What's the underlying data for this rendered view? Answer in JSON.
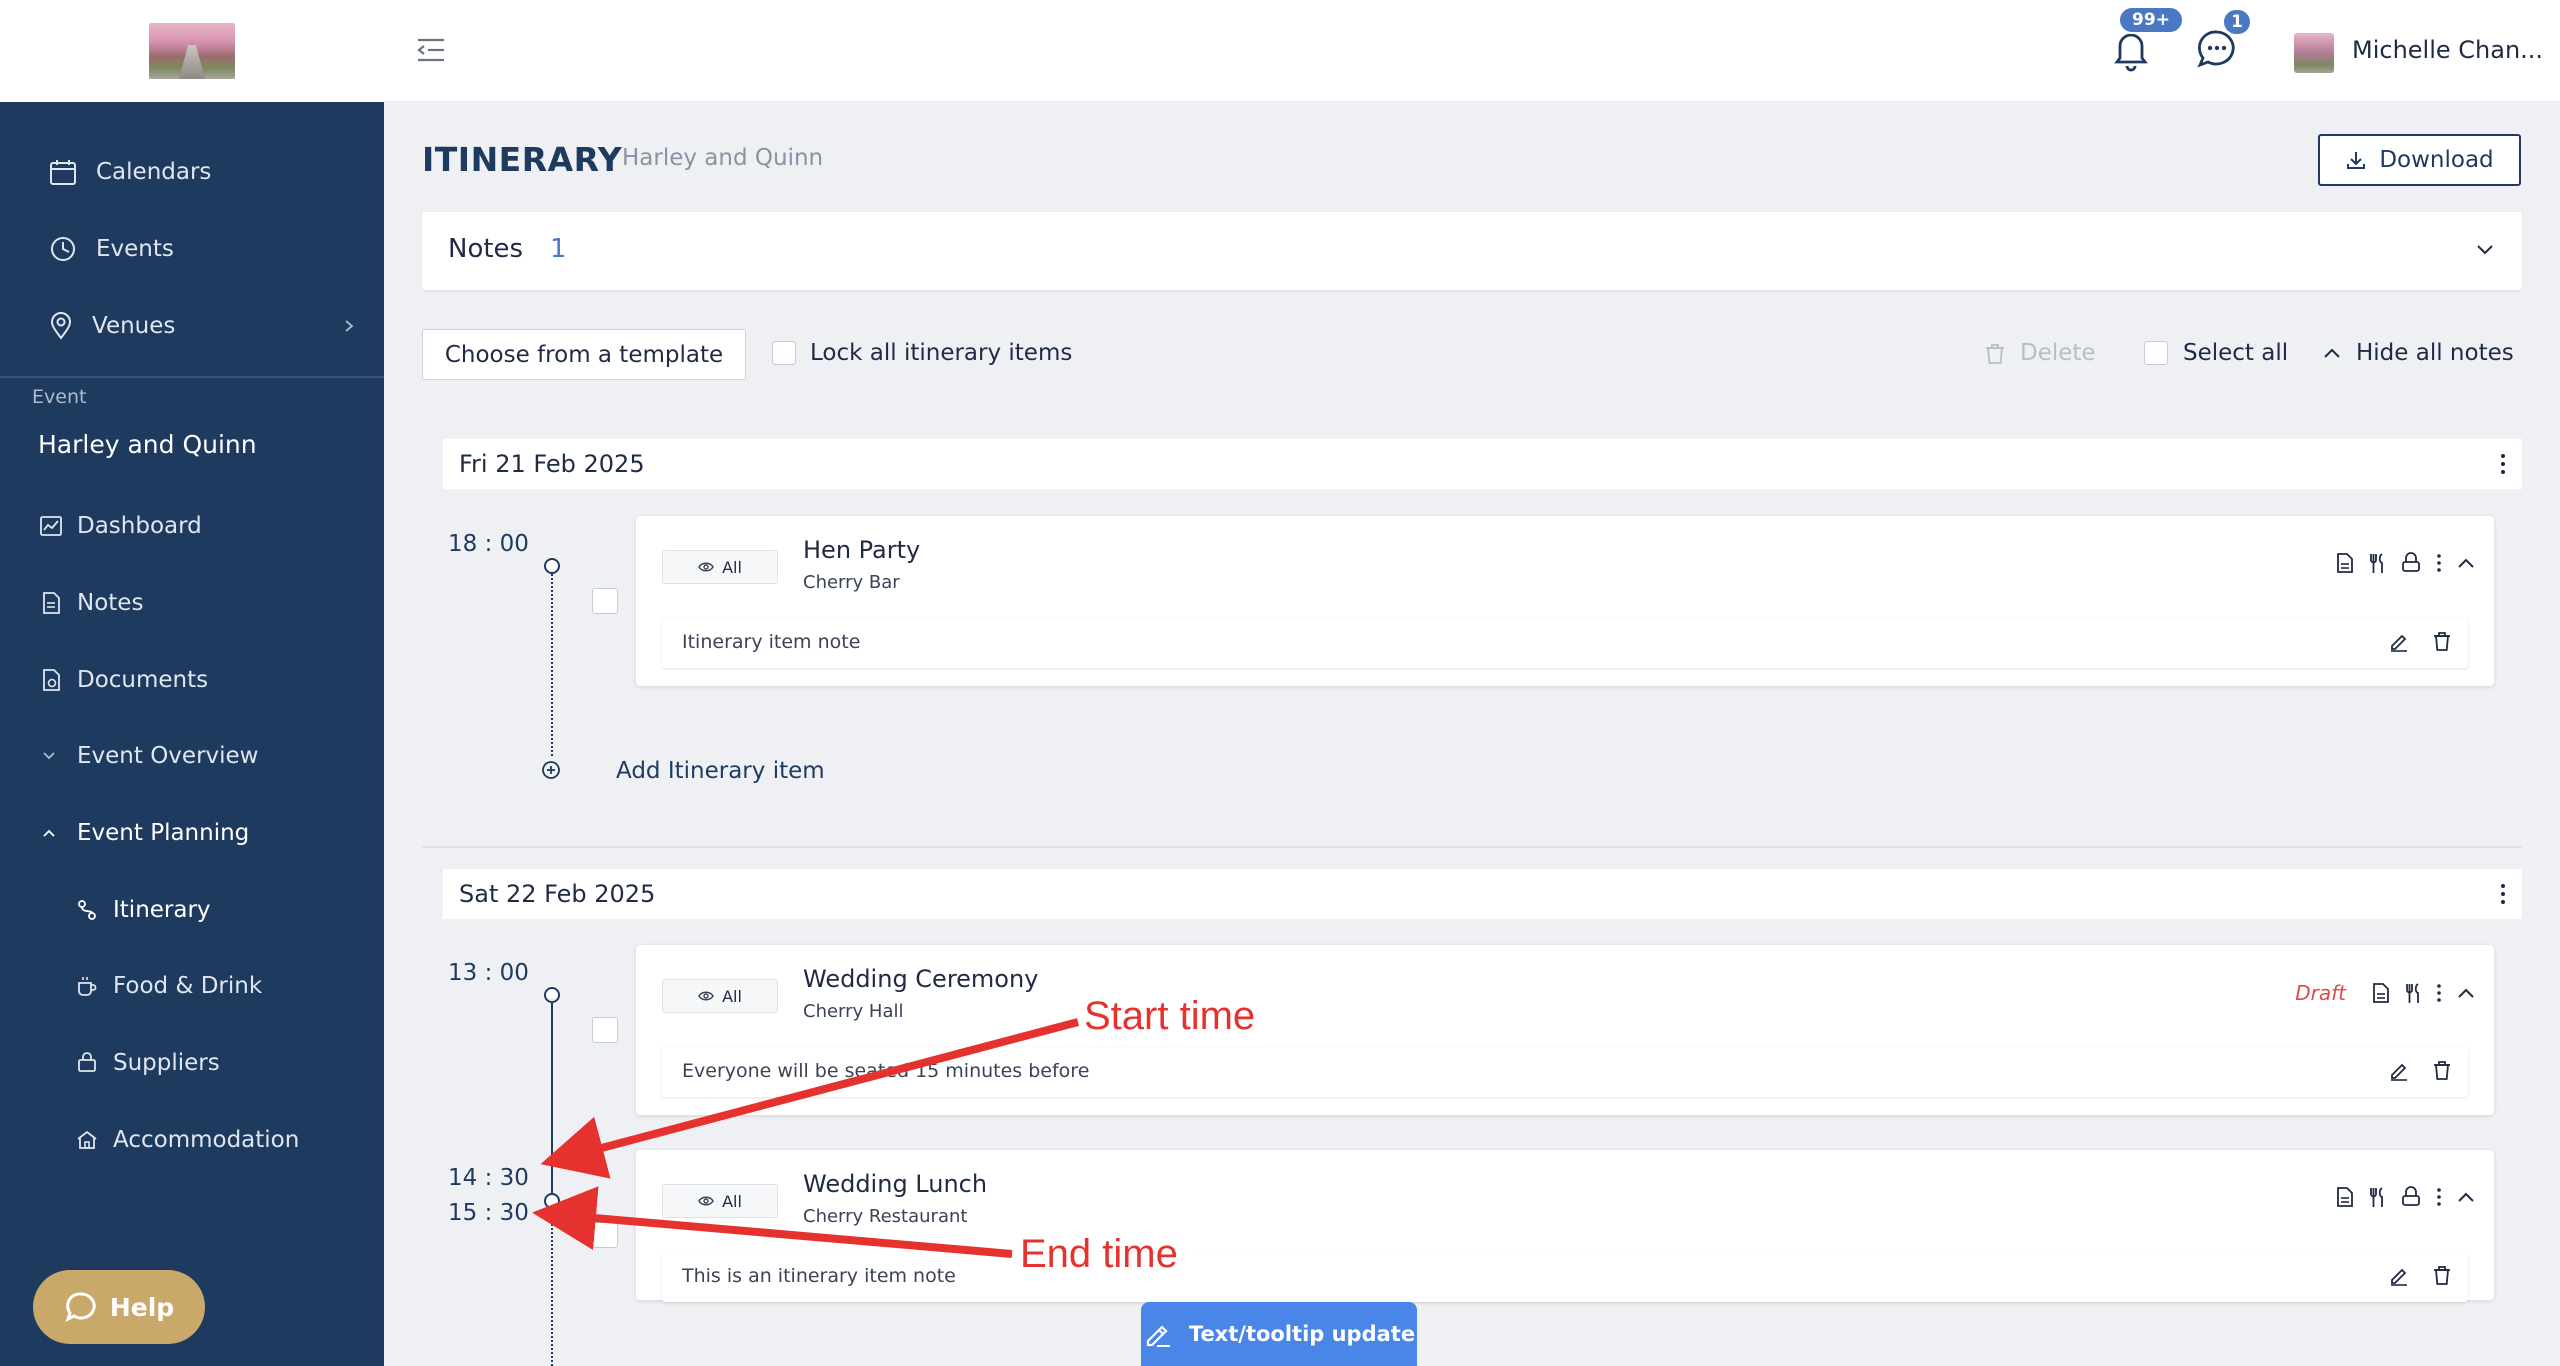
{
  "sidebar": {
    "nav": [
      {
        "label": "Calendars",
        "icon": "calendar-icon"
      },
      {
        "label": "Events",
        "icon": "events-icon"
      },
      {
        "label": "Venues",
        "icon": "location-pin-icon"
      }
    ],
    "event_caption": "Event",
    "event_name": "Harley and Quinn",
    "event_nav": [
      {
        "label": "Dashboard",
        "icon": "dashboard-icon"
      },
      {
        "label": "Notes",
        "icon": "notes-icon"
      },
      {
        "label": "Documents",
        "icon": "documents-icon"
      },
      {
        "label": "Event Overview",
        "icon": "chevron-down-icon"
      },
      {
        "label": "Event Planning",
        "icon": "chevron-up-icon"
      },
      {
        "label": "Itinerary",
        "icon": "itinerary-icon"
      },
      {
        "label": "Food & Drink",
        "icon": "food-drink-icon"
      },
      {
        "label": "Suppliers",
        "icon": "suppliers-icon"
      },
      {
        "label": "Accommodation",
        "icon": "home-icon"
      }
    ],
    "help_label": "Help"
  },
  "topbar": {
    "notifications_badge": "99+",
    "messages_badge": "1",
    "user_name": "Michelle Chan..."
  },
  "page": {
    "title": "ITINERARY",
    "subtitle": "Harley and Quinn",
    "download_label": "Download",
    "notes_label": "Notes",
    "notes_count": "1",
    "template_button": "Choose from a template",
    "lock_all_label": "Lock all itinerary items",
    "delete_label": "Delete",
    "select_all_label": "Select all",
    "hide_notes_label": "Hide all notes"
  },
  "days": [
    {
      "date": "Fri 21 Feb 2025",
      "items": [
        {
          "start": "18",
          "start_min": "00",
          "visibility": "All",
          "title": "Hen Party",
          "venue": "Cherry Bar",
          "note": "Itinerary item note"
        }
      ],
      "add_label": "Add Itinerary item"
    },
    {
      "date": "Sat 22 Feb 2025",
      "items": [
        {
          "start": "13",
          "start_min": "00",
          "end": "14",
          "end_min": "30",
          "visibility": "All",
          "title": "Wedding Ceremony",
          "venue": "Cherry Hall",
          "status": "Draft",
          "note": "Everyone will be seated 15 minutes before"
        },
        {
          "start": "15",
          "start_min": "30",
          "visibility": "All",
          "title": "Wedding Lunch",
          "venue": "Cherry Restaurant",
          "note": "This is an itinerary item note"
        }
      ]
    }
  ],
  "annotations": {
    "start_time": "Start time",
    "end_time": "End time",
    "color": "#e6322e"
  },
  "feedback_button": "Text/tooltip update",
  "colors": {
    "sidebar": "#1f3a5f",
    "accent": "#4a78c2",
    "help": "#c9a96a",
    "draft": "#e04848"
  }
}
